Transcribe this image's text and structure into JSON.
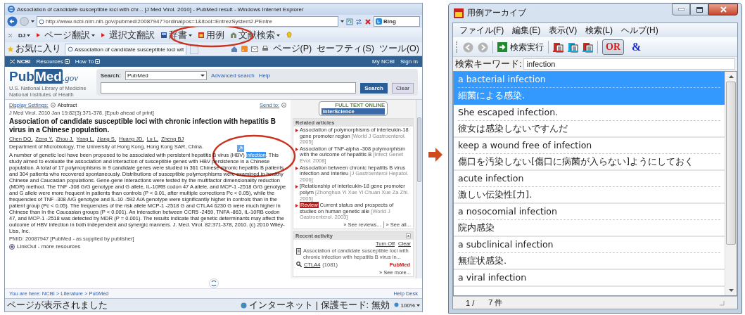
{
  "browser": {
    "title": "Association of candidate susceptible loci with chr... [J Med Virol. 2010] - PubMed result - Windows Internet Explorer",
    "address": "http://www.ncbi.nlm.nih.gov/pubmed/20087947?ordinalpos=1&itool=EntrezSystem2.PEntre",
    "search_provider": "Bing",
    "toolbar": [
      {
        "kind": "dj",
        "label": "DJ",
        "dropdown": true,
        "circled": false
      },
      {
        "kind": "translate",
        "label": "ページ翻訳",
        "dropdown": true,
        "circled": false
      },
      {
        "kind": "translate",
        "label": "選択文翻訳",
        "dropdown": false,
        "circled": false
      },
      {
        "kind": "dictionary",
        "label": "辞書",
        "dropdown": true,
        "circled": false
      },
      {
        "kind": "examples",
        "label": "用例",
        "dropdown": false,
        "circled": true
      },
      {
        "kind": "literature",
        "label": "文献検索",
        "dropdown": true,
        "circled": false
      }
    ],
    "favorites": "お気に入り",
    "tab": "Association of candidate susceptible loci wit",
    "commands": [
      "ページ(P)",
      "セーフティ(S)",
      "ツール(O)"
    ],
    "site_nav": {
      "brand": "NCBI",
      "menus": [
        "Resources",
        "How To"
      ],
      "account": [
        "My NCBI",
        "Sign In"
      ]
    },
    "logo": {
      "pub": "Pub",
      "med": "Med",
      "gov": ".gov",
      "lines": [
        "U.S. National Library of Medicine",
        "National Institutes of Health"
      ]
    },
    "search": {
      "label": "Search:",
      "database": "PubMed",
      "links": [
        "Advanced search",
        "Help"
      ],
      "buttons": [
        "Search",
        "Clear"
      ]
    },
    "article": {
      "display_settings": "Display Settings:",
      "format": "Abstract",
      "send_to": "Send to:",
      "citation": "J Med Virol. 2010 Jan 19;82(3):371-378. [Epub ahead of print]",
      "title": "Association of candidate susceptible loci with chronic infection with hepatitis B virus in a Chinese population.",
      "authors": [
        "Chen DQ,",
        "Zeng Y,",
        "Zhou J,",
        "Yang L,",
        "Jiang S,",
        "Huang JD,",
        "Lu L,",
        "Zheng BJ"
      ],
      "affiliation": "Department of Microbiology, The University of Hong Kong, Hong Kong SAR, China.",
      "abstract": {
        "before": "A number of genetic loci have been proposed to be associated with persistent hepatitis B virus (HBV) ",
        "highlighted": "infection",
        "after": ". This study aimed to evaluate the association and interaction of susceptible genes with HBV persistence in a Chinese population. A total of 17 polymorphisms in 9 candidate genes were studied in 361 Chinese chronic hepatitis B patients and 304 patients who recovered spontaneously. Distributions of susceptible polymorphisms were examined in healthy Chinese and Caucasian populations. Gene-gene interactions were tested by the multifactor dimensionality reduction (MDR) method. The TNF -308 G/G genotype and G allele, IL-10RB codon 47 A allele, and MCP-1 -2518 G/G genotype and G allele were more frequent in patients than controls (P < 0.01, after multiple corrections Pc < 0.05), while the frequencies of TNF -308 A/G genotype and IL-10 -592 A/A genotype were significantly higher in controls than in the patient group (Pc < 0.05). The frequencies of the risk allele MCP-1 -2518 G and CTLA4 6230 G were much higher in Chinese than in the Caucasian groups (P < 0.001). An interaction between CCR5 -2459, TNFA -863, IL-10RB codon 47, and MCP-1 -2518 was detected by MDR (P = 0.001). The results indicate that genetic determinants may affect the outcome of HBV infection in both independent and synergic manners. J. Med. Virol. 82:371-378, 2010. (c) 2010 Wiley-Liss, Inc.",
        "circled": true
      },
      "pmid": "PMID: 20087947 [PubMed - as supplied by publisher]",
      "linkout": "LinkOut - more resources"
    },
    "sidebar": {
      "banner": [
        "FULL TEXT ONLINE",
        "InterScience"
      ],
      "related_title": "Related articles",
      "related": [
        {
          "title": "Association of polymorphisms of interleukin-18 gene promoter region ",
          "source": "[World J Gastroenterol. 2005]"
        },
        {
          "title": "Association of TNF-alpha -308 polymorphism with the outcome of hepatitis B ",
          "source": "[Infect Genet Evol. 2008]"
        },
        {
          "title": "Association between chronic hepatitis B virus infection and interleu ",
          "source": "[J Gastroenterol Hepatol. 2006]"
        },
        {
          "title": "[Relationship of interleukin-18 gene promoter polym ",
          "source": "[Zhonghua Yi Xue Yi Chuan Xue Za Zhi. 2005]"
        },
        {
          "badge": "Review",
          "title": "Current status and prospects of studies on human genetic alle ",
          "source": "[World J Gastroenterol. 2003]"
        }
      ],
      "more": [
        "» See reviews...",
        "» See all..."
      ],
      "recent_title": "Recent activity",
      "recent_actions": [
        "Turn Off",
        "Clear"
      ],
      "recent": [
        {
          "kind": "document",
          "text": "Association of candidate susceptible loci with chronic infection with hepatitis B virus in..."
        },
        {
          "kind": "search",
          "term": "CTLA4",
          "count": "(1081)",
          "database": "PubMed"
        }
      ],
      "see_more": "» See more..."
    },
    "breadcrumb": "You are here: NCBI > Literature > PubMed",
    "help_desk": "Help Desk",
    "status": {
      "text": "ページが表示されました",
      "zone": "インターネット | 保護モード: 無効",
      "zoom": "100%"
    }
  },
  "app": {
    "title": "用例アーカイブ",
    "menu": [
      "ファイル(F)",
      "編集(E)",
      "表示(V)",
      "検索(L)",
      "ヘルプ(H)"
    ],
    "toolbar": {
      "back_disabled": true,
      "forward_disabled": true,
      "run": "検索実行",
      "toggles": [
        {
          "label": "OR",
          "selected": true
        },
        {
          "label": "&",
          "selected": false
        }
      ]
    },
    "search": {
      "label": "検索キーワード:",
      "value": "infection"
    },
    "results": [
      {
        "en": "a bacterial infection",
        "ja": "細菌による感染.",
        "selected": true
      },
      {
        "en": "She escaped infection.",
        "ja": "彼女は感染しないですんだ",
        "selected": false
      },
      {
        "en": "keep a wound free of infection",
        "ja": "傷口を汚染しない[傷口に病菌が入らない]ようにしておく",
        "selected": false
      },
      {
        "en": "acute infection",
        "ja": "激しい伝染性[力].",
        "selected": false
      },
      {
        "en": "a nosocomial infection",
        "ja": "院内感染",
        "selected": false
      },
      {
        "en": "a subclinical infection",
        "ja": "無症状感染.",
        "selected": false
      },
      {
        "en": "a viral infection",
        "selected": false
      }
    ],
    "status": {
      "position": "1 /",
      "count": "7 件"
    }
  }
}
